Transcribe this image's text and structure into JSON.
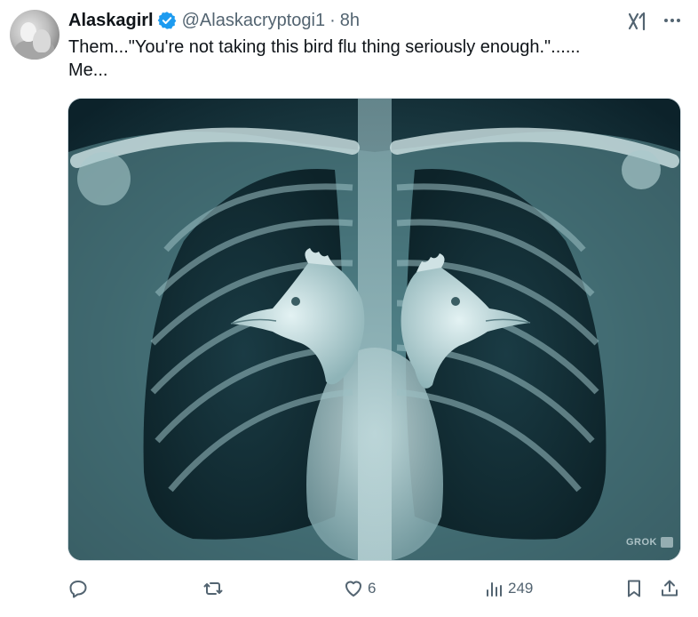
{
  "author": {
    "display_name": "Alaskagirl",
    "handle": "@Alaskacryptogi1",
    "separator": "·",
    "time": "8h",
    "verified": true
  },
  "tweet": {
    "text_line1": "Them...\"You're not taking this bird flu thing seriously enough.\"......",
    "text_line2": "Me..."
  },
  "media": {
    "description_icon": "chest-xray-with-chicken-heads",
    "watermark": "GROK"
  },
  "actions": {
    "reply_count": "",
    "retweet_count": "",
    "like_count": "6",
    "views_count": "249"
  },
  "colors": {
    "text": "#0f1419",
    "secondary": "#536471",
    "verified_blue": "#1d9bf0",
    "border": "#cfd9de"
  }
}
